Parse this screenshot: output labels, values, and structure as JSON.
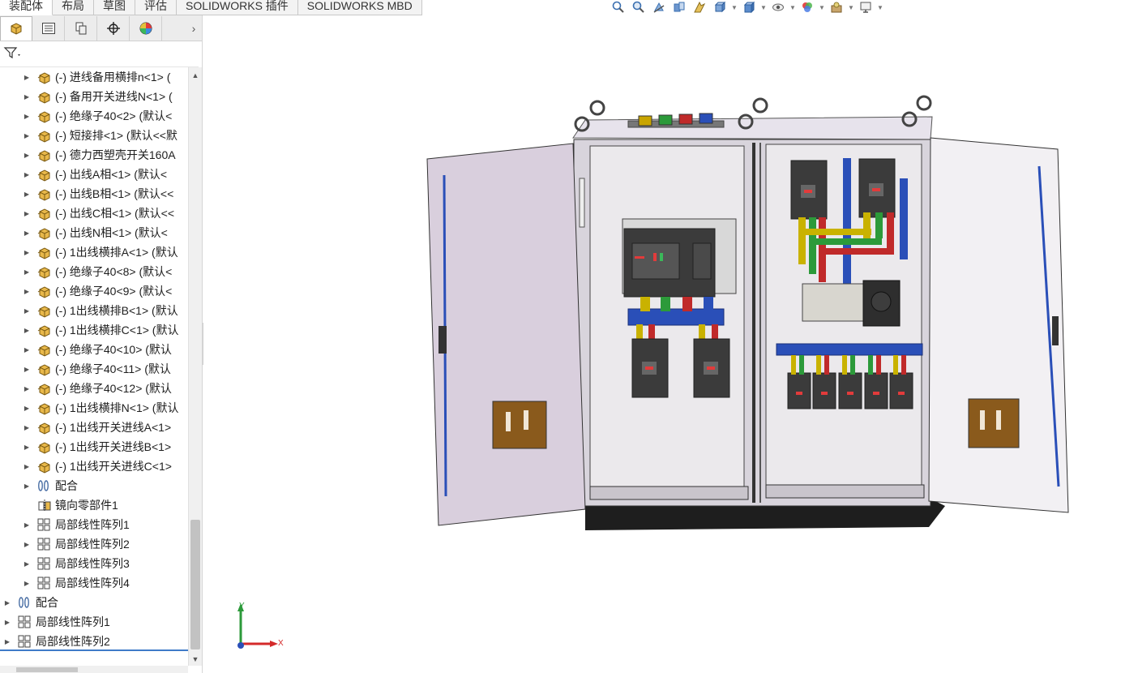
{
  "command_tabs": [
    {
      "label": "装配体",
      "active": true
    },
    {
      "label": "布局",
      "active": false
    },
    {
      "label": "草图",
      "active": false
    },
    {
      "label": "评估",
      "active": false
    },
    {
      "label": "SOLIDWORKS 插件",
      "active": false
    },
    {
      "label": "SOLIDWORKS MBD",
      "active": false
    }
  ],
  "heads_up_toolbar": [
    "zoom-to-fit-icon",
    "zoom-to-area-icon",
    "previous-view-icon",
    "section-view-icon",
    "dynamic-annotation-icon",
    "view-orientation-icon",
    "display-style-icon",
    "hide-show-items-icon",
    "edit-appearance-icon",
    "apply-scene-icon",
    "view-settings-icon"
  ],
  "panel_tabs": [
    "featuremanager-tree-icon",
    "propertymanager-icon",
    "configurationmanager-icon",
    "dimxpertmanager-icon",
    "displaymanager-icon"
  ],
  "tree": {
    "items": [
      {
        "label": "(-) 进线备用横排n<1> (",
        "type": "part",
        "indent": 1,
        "expandable": true
      },
      {
        "label": "(-) 备用开关进线N<1> (",
        "type": "part",
        "indent": 1,
        "expandable": true
      },
      {
        "label": "(-) 绝缘子40<2> (默认<",
        "type": "part",
        "indent": 1,
        "expandable": true
      },
      {
        "label": "(-) 短接排<1> (默认<<默",
        "type": "part",
        "indent": 1,
        "expandable": true
      },
      {
        "label": "(-) 德力西塑壳开关160A",
        "type": "part",
        "indent": 1,
        "expandable": true
      },
      {
        "label": "(-) 出线A相<1> (默认<",
        "type": "part",
        "indent": 1,
        "expandable": true
      },
      {
        "label": "(-) 出线B相<1> (默认<<",
        "type": "part",
        "indent": 1,
        "expandable": true
      },
      {
        "label": "(-) 出线C相<1> (默认<<",
        "type": "part",
        "indent": 1,
        "expandable": true
      },
      {
        "label": "(-) 出线N相<1> (默认<",
        "type": "part",
        "indent": 1,
        "expandable": true
      },
      {
        "label": "(-) 1出线横排A<1> (默认",
        "type": "part",
        "indent": 1,
        "expandable": true
      },
      {
        "label": "(-) 绝缘子40<8> (默认<",
        "type": "part",
        "indent": 1,
        "expandable": true
      },
      {
        "label": "(-) 绝缘子40<9> (默认<",
        "type": "part",
        "indent": 1,
        "expandable": true
      },
      {
        "label": "(-) 1出线横排B<1> (默认",
        "type": "part",
        "indent": 1,
        "expandable": true
      },
      {
        "label": "(-) 1出线横排C<1> (默认",
        "type": "part",
        "indent": 1,
        "expandable": true
      },
      {
        "label": "(-) 绝缘子40<10> (默认",
        "type": "part",
        "indent": 1,
        "expandable": true
      },
      {
        "label": "(-) 绝缘子40<11> (默认",
        "type": "part",
        "indent": 1,
        "expandable": true
      },
      {
        "label": "(-) 绝缘子40<12> (默认",
        "type": "part",
        "indent": 1,
        "expandable": true
      },
      {
        "label": "(-) 1出线横排N<1> (默认",
        "type": "part",
        "indent": 1,
        "expandable": true
      },
      {
        "label": "(-) 1出线开关进线A<1>",
        "type": "part",
        "indent": 1,
        "expandable": true
      },
      {
        "label": "(-) 1出线开关进线B<1>",
        "type": "part",
        "indent": 1,
        "expandable": true
      },
      {
        "label": "(-) 1出线开关进线C<1>",
        "type": "part",
        "indent": 1,
        "expandable": true
      },
      {
        "label": "配合",
        "type": "mates",
        "indent": 1,
        "expandable": true
      },
      {
        "label": "镜向零部件1",
        "type": "mirror",
        "indent": 1,
        "expandable": false
      },
      {
        "label": "局部线性阵列1",
        "type": "pattern",
        "indent": 1,
        "expandable": true
      },
      {
        "label": "局部线性阵列2",
        "type": "pattern",
        "indent": 1,
        "expandable": true
      },
      {
        "label": "局部线性阵列3",
        "type": "pattern",
        "indent": 1,
        "expandable": true
      },
      {
        "label": "局部线性阵列4",
        "type": "pattern",
        "indent": 1,
        "expandable": true
      },
      {
        "label": "配合",
        "type": "mates",
        "indent": 0,
        "expandable": true
      },
      {
        "label": "局部线性阵列1",
        "type": "pattern",
        "indent": 0,
        "expandable": true
      },
      {
        "label": "局部线性阵列2",
        "type": "pattern",
        "indent": 0,
        "expandable": true
      }
    ]
  },
  "triad": {
    "x_label": "X",
    "y_label": "Y"
  },
  "colors": {
    "accent": "#3f7bc8",
    "part_icon": "#e8b84a",
    "viewport_bg": "#ffffff"
  }
}
